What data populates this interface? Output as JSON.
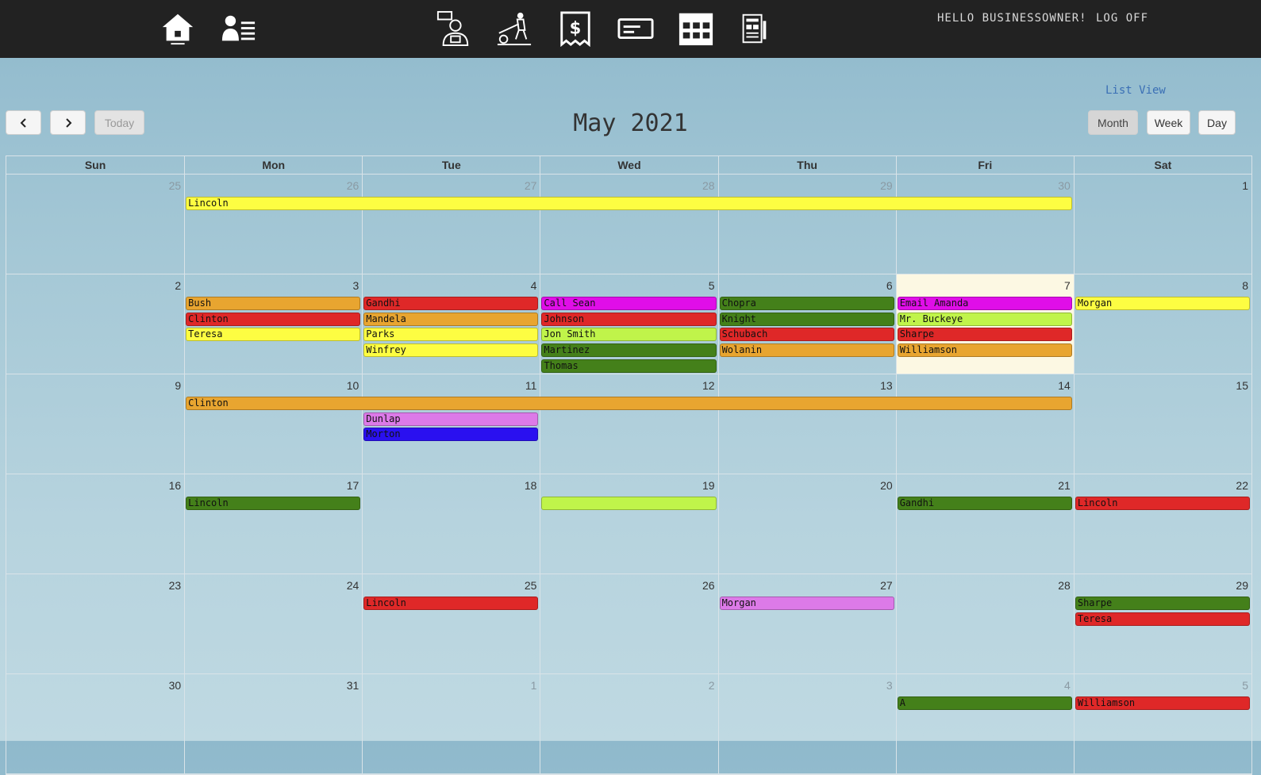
{
  "nav": {
    "icons": [
      "home-icon",
      "customers-icon",
      "sales-icon",
      "landscaping-icon",
      "invoice-icon",
      "payment-card-icon",
      "calendar-icon",
      "jobs-icon"
    ],
    "greeting": "HELLO BUSINESSOWNER!",
    "logoff": "LOG OFF"
  },
  "toolbar": {
    "list_view": "List View",
    "prev": "‹",
    "next": "›",
    "today": "Today",
    "title": "May 2021",
    "views": [
      "Month",
      "Week",
      "Day"
    ],
    "active_view": "Month"
  },
  "day_headers": [
    "Sun",
    "Mon",
    "Tue",
    "Wed",
    "Thu",
    "Fri",
    "Sat"
  ],
  "today_date": "2021-05-07",
  "weeks": [
    {
      "days": [
        {
          "n": "25",
          "other": true
        },
        {
          "n": "26",
          "other": true
        },
        {
          "n": "27",
          "other": true
        },
        {
          "n": "28",
          "other": true
        },
        {
          "n": "29",
          "other": true
        },
        {
          "n": "30",
          "other": true
        },
        {
          "n": "1",
          "other": false
        }
      ]
    },
    {
      "days": [
        {
          "n": "2",
          "other": false
        },
        {
          "n": "3",
          "other": false
        },
        {
          "n": "4",
          "other": false
        },
        {
          "n": "5",
          "other": false
        },
        {
          "n": "6",
          "other": false
        },
        {
          "n": "7",
          "other": false,
          "today": true
        },
        {
          "n": "8",
          "other": false
        }
      ]
    },
    {
      "days": [
        {
          "n": "9",
          "other": false
        },
        {
          "n": "10",
          "other": false
        },
        {
          "n": "11",
          "other": false
        },
        {
          "n": "12",
          "other": false
        },
        {
          "n": "13",
          "other": false
        },
        {
          "n": "14",
          "other": false
        },
        {
          "n": "15",
          "other": false
        }
      ]
    },
    {
      "days": [
        {
          "n": "16",
          "other": false
        },
        {
          "n": "17",
          "other": false
        },
        {
          "n": "18",
          "other": false
        },
        {
          "n": "19",
          "other": false
        },
        {
          "n": "20",
          "other": false
        },
        {
          "n": "21",
          "other": false
        },
        {
          "n": "22",
          "other": false
        }
      ]
    },
    {
      "days": [
        {
          "n": "23",
          "other": false
        },
        {
          "n": "24",
          "other": false
        },
        {
          "n": "25",
          "other": false
        },
        {
          "n": "26",
          "other": false
        },
        {
          "n": "27",
          "other": false
        },
        {
          "n": "28",
          "other": false
        },
        {
          "n": "29",
          "other": false
        }
      ]
    },
    {
      "days": [
        {
          "n": "30",
          "other": false
        },
        {
          "n": "31",
          "other": false
        },
        {
          "n": "1",
          "other": true
        },
        {
          "n": "2",
          "other": true
        },
        {
          "n": "3",
          "other": true
        },
        {
          "n": "4",
          "other": true
        },
        {
          "n": "5",
          "other": true
        }
      ]
    }
  ],
  "colors": {
    "yellow": "#fdfd42",
    "orange": "#e8a530",
    "red": "#df2828",
    "magenta": "#e00ee8",
    "lime": "#c0f44a",
    "green": "#44801a",
    "violet": "#dc7ae8",
    "blue": "#2a10f0",
    "today_bg": "#fcf8e3"
  },
  "events": [
    {
      "week": 0,
      "start": 1,
      "end": 5,
      "row": 0,
      "title": "Lincoln",
      "color": "yellow"
    },
    {
      "week": 1,
      "start": 1,
      "end": 1,
      "row": 0,
      "title": "Bush",
      "color": "orange"
    },
    {
      "week": 1,
      "start": 1,
      "end": 1,
      "row": 1,
      "title": "Clinton",
      "color": "red"
    },
    {
      "week": 1,
      "start": 1,
      "end": 1,
      "row": 2,
      "title": "Teresa",
      "color": "yellow"
    },
    {
      "week": 1,
      "start": 2,
      "end": 2,
      "row": 0,
      "title": "Gandhi",
      "color": "red"
    },
    {
      "week": 1,
      "start": 2,
      "end": 2,
      "row": 1,
      "title": "Mandela",
      "color": "orange"
    },
    {
      "week": 1,
      "start": 2,
      "end": 2,
      "row": 2,
      "title": "Parks",
      "color": "yellow"
    },
    {
      "week": 1,
      "start": 2,
      "end": 2,
      "row": 3,
      "title": "Winfrey",
      "color": "yellow"
    },
    {
      "week": 1,
      "start": 3,
      "end": 3,
      "row": 0,
      "title": "Call Sean",
      "color": "magenta"
    },
    {
      "week": 1,
      "start": 3,
      "end": 3,
      "row": 1,
      "title": "Johnson",
      "color": "red"
    },
    {
      "week": 1,
      "start": 3,
      "end": 3,
      "row": 2,
      "title": "Jon Smith",
      "color": "lime"
    },
    {
      "week": 1,
      "start": 3,
      "end": 3,
      "row": 3,
      "title": "Martinez",
      "color": "green"
    },
    {
      "week": 1,
      "start": 3,
      "end": 3,
      "row": 4,
      "title": "Thomas",
      "color": "green"
    },
    {
      "week": 1,
      "start": 4,
      "end": 4,
      "row": 0,
      "title": "Chopra",
      "color": "green"
    },
    {
      "week": 1,
      "start": 4,
      "end": 4,
      "row": 1,
      "title": "Knight",
      "color": "green"
    },
    {
      "week": 1,
      "start": 4,
      "end": 4,
      "row": 2,
      "title": "Schubach",
      "color": "red"
    },
    {
      "week": 1,
      "start": 4,
      "end": 4,
      "row": 3,
      "title": "Wolanin",
      "color": "orange"
    },
    {
      "week": 1,
      "start": 5,
      "end": 5,
      "row": 0,
      "title": "Email Amanda",
      "color": "magenta"
    },
    {
      "week": 1,
      "start": 5,
      "end": 5,
      "row": 1,
      "title": "Mr. Buckeye",
      "color": "lime"
    },
    {
      "week": 1,
      "start": 5,
      "end": 5,
      "row": 2,
      "title": "Sharpe",
      "color": "red"
    },
    {
      "week": 1,
      "start": 5,
      "end": 5,
      "row": 3,
      "title": "Williamson",
      "color": "orange"
    },
    {
      "week": 1,
      "start": 6,
      "end": 6,
      "row": 0,
      "title": "Morgan",
      "color": "yellow"
    },
    {
      "week": 2,
      "start": 1,
      "end": 5,
      "row": 0,
      "title": "Clinton",
      "color": "orange"
    },
    {
      "week": 2,
      "start": 2,
      "end": 2,
      "row": 1,
      "title": "Dunlap",
      "color": "violet"
    },
    {
      "week": 2,
      "start": 2,
      "end": 2,
      "row": 2,
      "title": "Morton",
      "color": "blue"
    },
    {
      "week": 3,
      "start": 1,
      "end": 1,
      "row": 0,
      "title": "Lincoln",
      "color": "green"
    },
    {
      "week": 3,
      "start": 3,
      "end": 3,
      "row": 0,
      "title": "",
      "color": "lime"
    },
    {
      "week": 3,
      "start": 5,
      "end": 5,
      "row": 0,
      "title": "Gandhi",
      "color": "green"
    },
    {
      "week": 3,
      "start": 6,
      "end": 6,
      "row": 0,
      "title": "Lincoln",
      "color": "red"
    },
    {
      "week": 4,
      "start": 2,
      "end": 2,
      "row": 0,
      "title": "Lincoln",
      "color": "red"
    },
    {
      "week": 4,
      "start": 4,
      "end": 4,
      "row": 0,
      "title": "Morgan",
      "color": "violet"
    },
    {
      "week": 4,
      "start": 6,
      "end": 6,
      "row": 0,
      "title": "Sharpe",
      "color": "green"
    },
    {
      "week": 4,
      "start": 6,
      "end": 6,
      "row": 1,
      "title": "Teresa",
      "color": "red"
    },
    {
      "week": 5,
      "start": 5,
      "end": 5,
      "row": 0,
      "title": "A",
      "color": "green"
    },
    {
      "week": 5,
      "start": 6,
      "end": 6,
      "row": 0,
      "title": "Williamson",
      "color": "red"
    }
  ]
}
